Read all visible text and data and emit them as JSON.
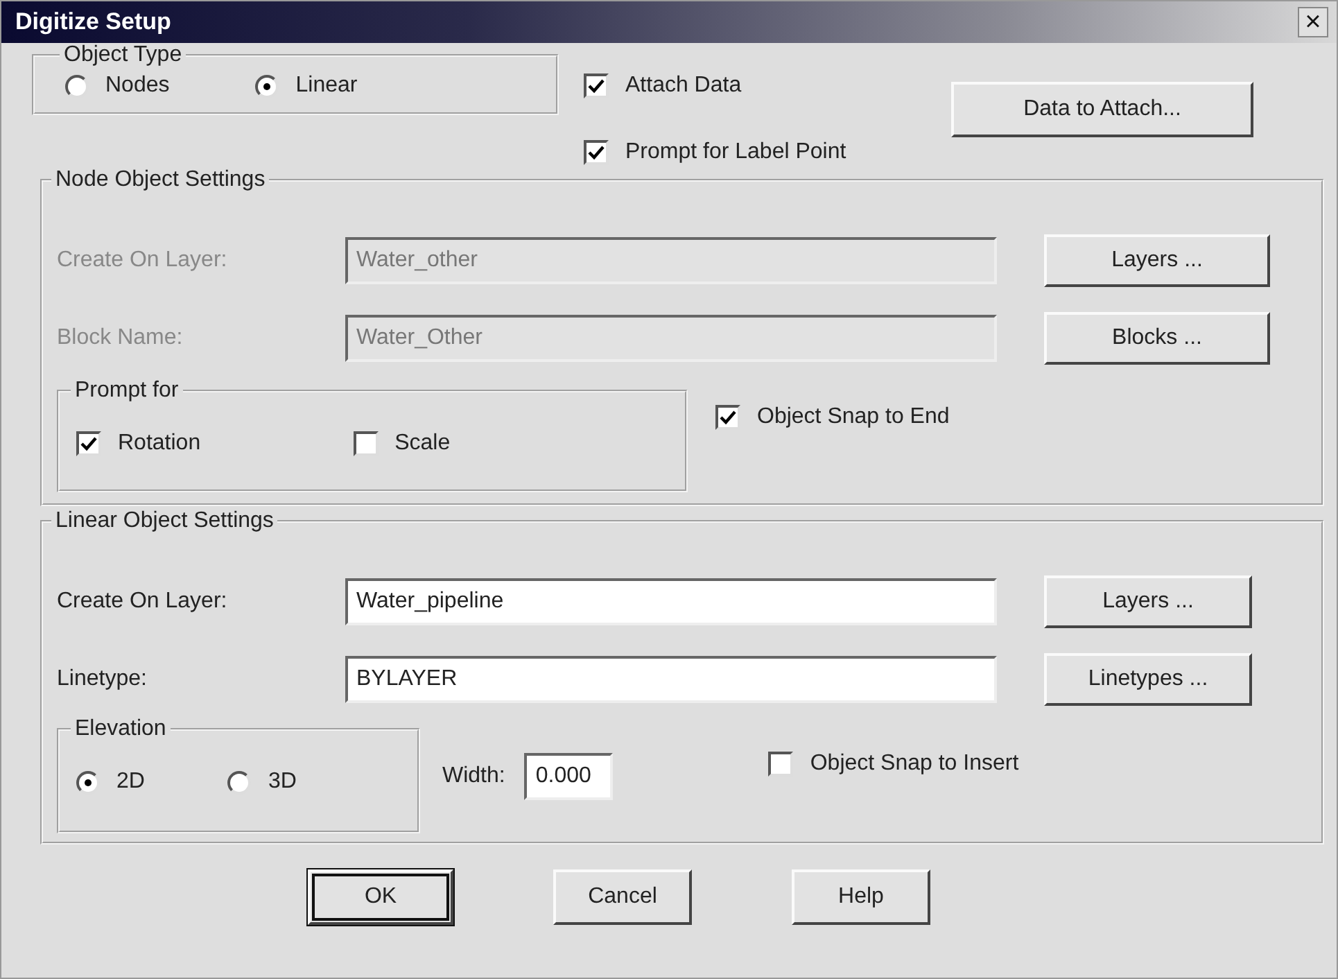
{
  "window": {
    "title": "Digitize Setup",
    "close": "×"
  },
  "object_type": {
    "title": "Object Type",
    "options": [
      {
        "label": "Nodes",
        "selected": false
      },
      {
        "label": "Linear",
        "selected": true
      }
    ]
  },
  "options": [
    {
      "label": "Attach Data",
      "checked": true
    },
    {
      "label": "Prompt for Label Point",
      "checked": true
    }
  ],
  "data_button": "Data to Attach...",
  "node_settings": {
    "title": "Node Object Settings",
    "disabled": true,
    "rows": [
      {
        "label": "Create On Layer:",
        "value": "Water_other",
        "button": "Layers ..."
      },
      {
        "label": "Block Name:",
        "value": "Water_Other",
        "button": "Blocks ..."
      }
    ],
    "prompt_for": {
      "title": "Prompt for",
      "items": [
        {
          "label": "Rotation",
          "checked": true
        },
        {
          "label": "Scale",
          "checked": false
        }
      ]
    },
    "snap": {
      "label": "Object Snap to End",
      "checked": true
    }
  },
  "linear_settings": {
    "title": "Linear Object Settings",
    "disabled": false,
    "rows": [
      {
        "label": "Create On Layer:",
        "value": "Water_pipeline",
        "button": "Layers ..."
      },
      {
        "label": "Linetype:",
        "value": "BYLAYER",
        "button": "Linetypes ..."
      }
    ],
    "elevation": {
      "title": "Elevation",
      "options": [
        {
          "label": "2D",
          "selected": true
        },
        {
          "label": "3D",
          "selected": false
        }
      ]
    },
    "width": {
      "label": "Width:",
      "value": "0.000"
    },
    "snap": {
      "label": "Object Snap to Insert",
      "checked": false
    }
  },
  "buttons": [
    {
      "label": "OK",
      "default": true
    },
    {
      "label": "Cancel",
      "default": false
    },
    {
      "label": "Help",
      "default": false
    }
  ]
}
